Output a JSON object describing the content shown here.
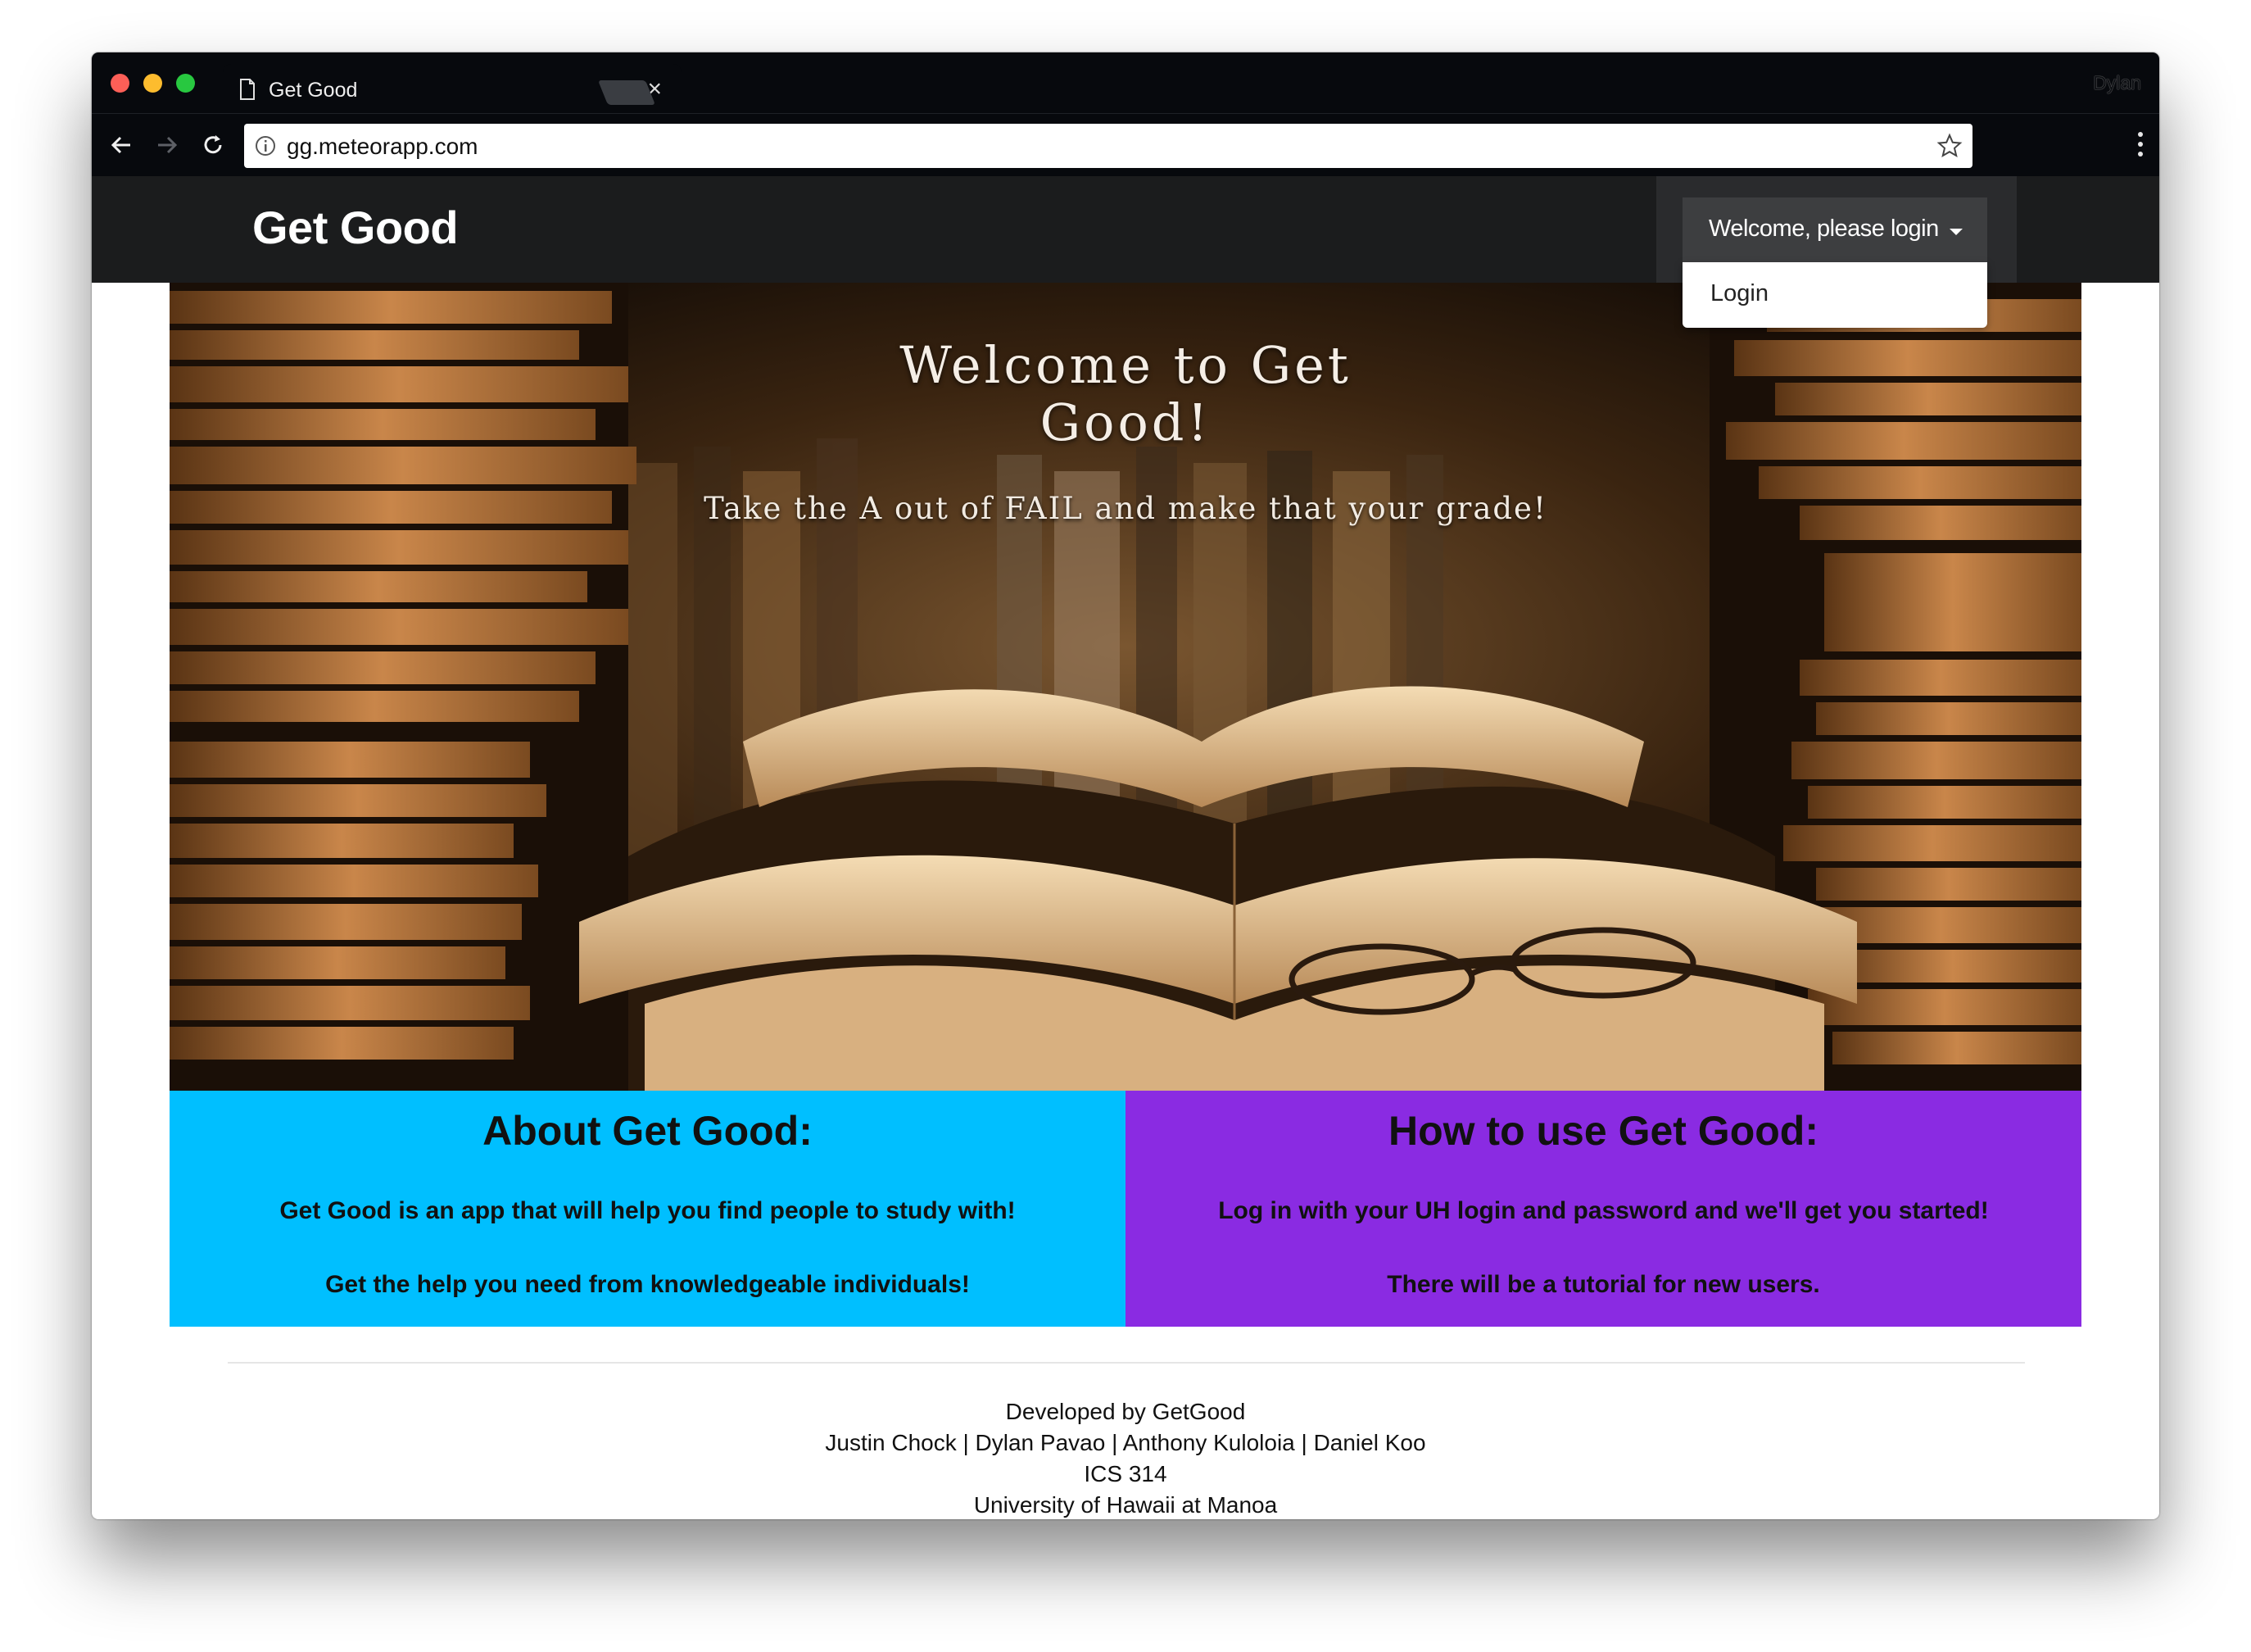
{
  "browser": {
    "tab_title": "Get Good",
    "url": "gg.meteorapp.com",
    "profile_name": "Dylan",
    "icons": {
      "tab": "document-icon",
      "close": "close-icon",
      "back": "back-arrow-icon",
      "forward": "forward-arrow-icon",
      "reload": "reload-icon",
      "info": "info-icon",
      "bookmark": "star-icon",
      "menu": "more-vertical-icon"
    }
  },
  "navbar": {
    "brand": "Get Good",
    "dropdown_label": "Welcome, please login",
    "dropdown_items": [
      "Login"
    ]
  },
  "hero": {
    "title_line1": "Welcome to Get",
    "title_line2": "Good!",
    "subtitle": "Take the A out of FAIL and make that your grade!"
  },
  "about": {
    "heading": "About Get Good:",
    "line1": "Get Good is an app that will help you find people to study with!",
    "line2": "Get the help you need from knowledgeable individuals!",
    "color": "#00bfff"
  },
  "how_to": {
    "heading": "How to use Get Good:",
    "line1": "Log in with your UH login and password and we'll get you started!",
    "line2": "There will be a tutorial for new users.",
    "color": "#8a2be2"
  },
  "footer": {
    "line1": "Developed by GetGood",
    "line2": "Justin Chock | Dylan Pavao | Anthony Kuloloia | Daniel Koo",
    "line3": "ICS 314",
    "line4": "University of Hawaii at Manoa"
  }
}
